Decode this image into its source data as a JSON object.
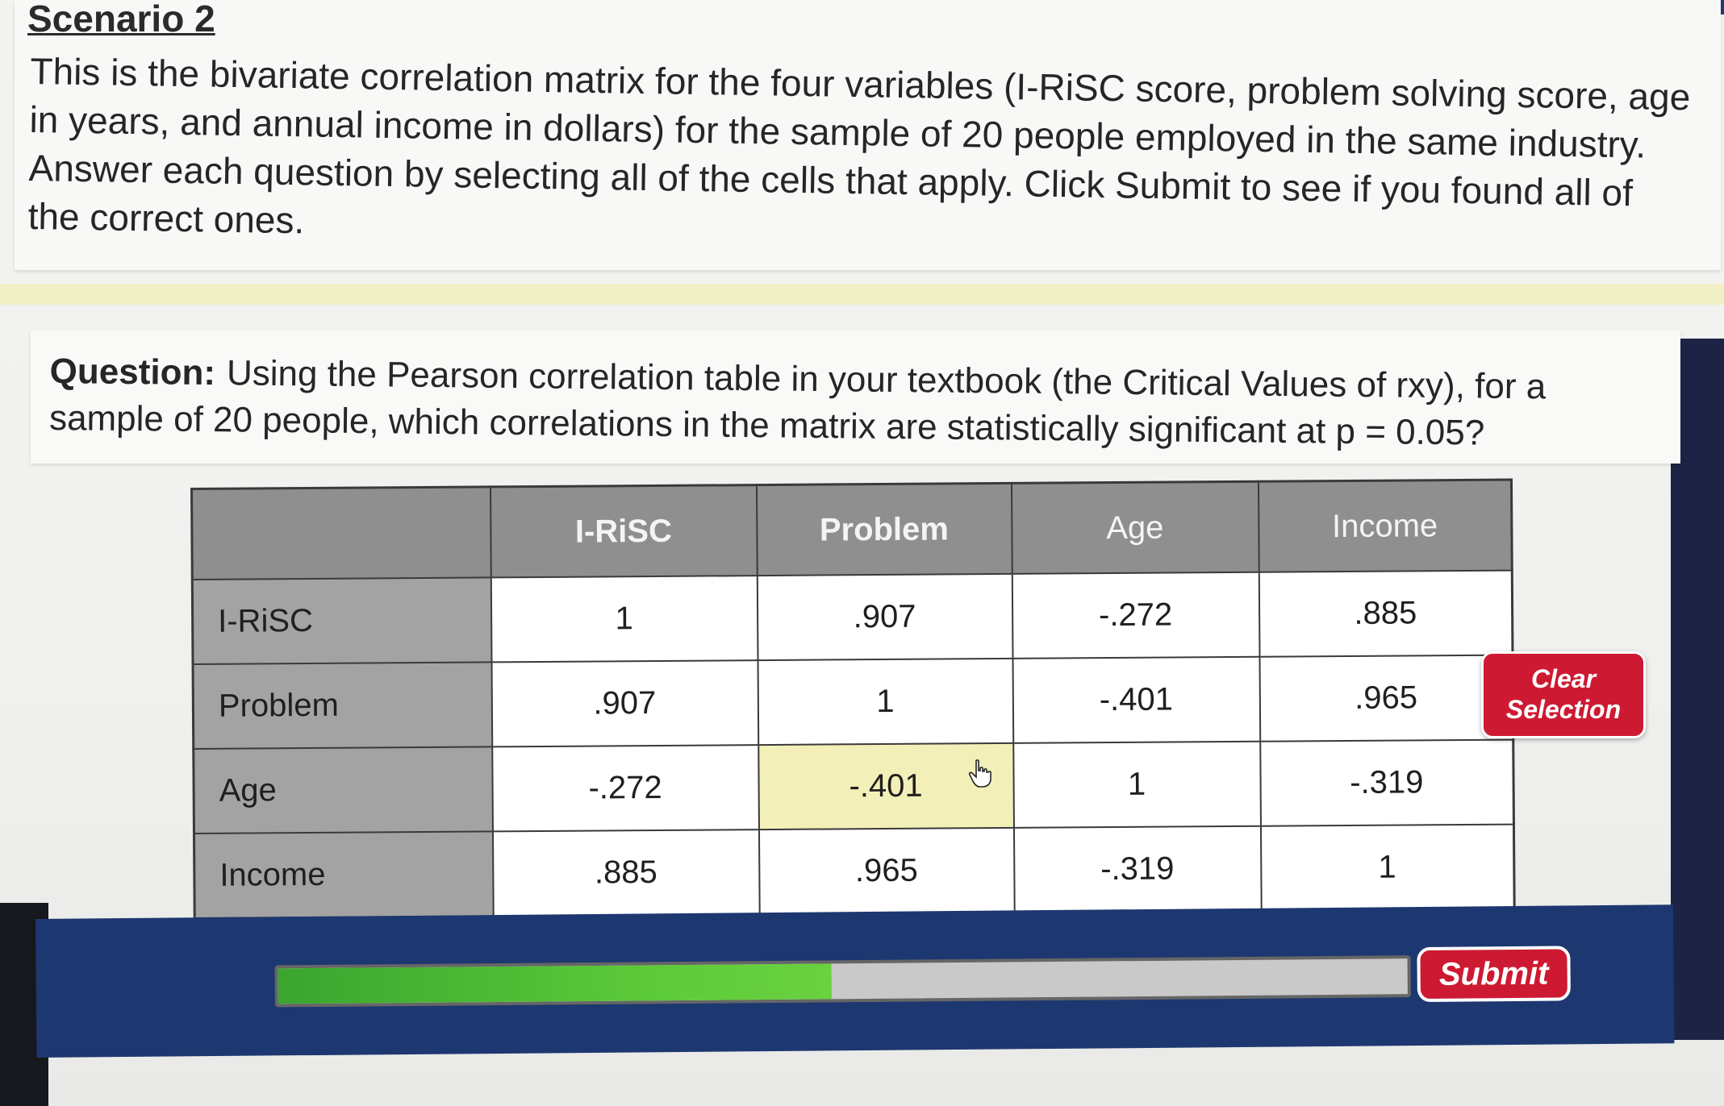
{
  "scenario": {
    "title": "Scenario 2",
    "text": "This is the bivariate correlation matrix for the four variables (I-RiSC score, problem solving score, age in years, and annual income in dollars) for the sample of 20 people employed in the same industry. Answer each question by selecting all of the cells that apply. Click Submit to see if you found all of the correct ones."
  },
  "question": {
    "label": "Question:",
    "text": "Using the Pearson correlation table in your textbook (the Critical Values of rxy), for a sample of 20 people, which correlations in the matrix are statistically significant at p = 0.05?"
  },
  "matrix": {
    "columns": [
      "I-RiSC",
      "Problem",
      "Age",
      "Income"
    ],
    "rows": [
      {
        "label": "I-RiSC",
        "cells": [
          "1",
          ".907",
          "-.272",
          ".885"
        ]
      },
      {
        "label": "Problem",
        "cells": [
          ".907",
          "1",
          "-.401",
          ".965"
        ]
      },
      {
        "label": "Age",
        "cells": [
          "-.272",
          "-.401",
          "1",
          "-.319"
        ]
      },
      {
        "label": "Income",
        "cells": [
          ".885",
          ".965",
          "-.319",
          "1"
        ]
      }
    ],
    "selected_cell": {
      "row": 2,
      "col": 1
    }
  },
  "buttons": {
    "clear_line1": "Clear",
    "clear_line2": "Selection",
    "submit": "Submit"
  },
  "progress": {
    "fraction": 0.49
  },
  "colors": {
    "accent_red": "#cd1a32",
    "footer_blue": "#1d3870",
    "progress_green": "#5ecb3a",
    "selected_yellow": "#f3efb8"
  },
  "icons": {
    "cursor": "hand-pointer-icon"
  }
}
